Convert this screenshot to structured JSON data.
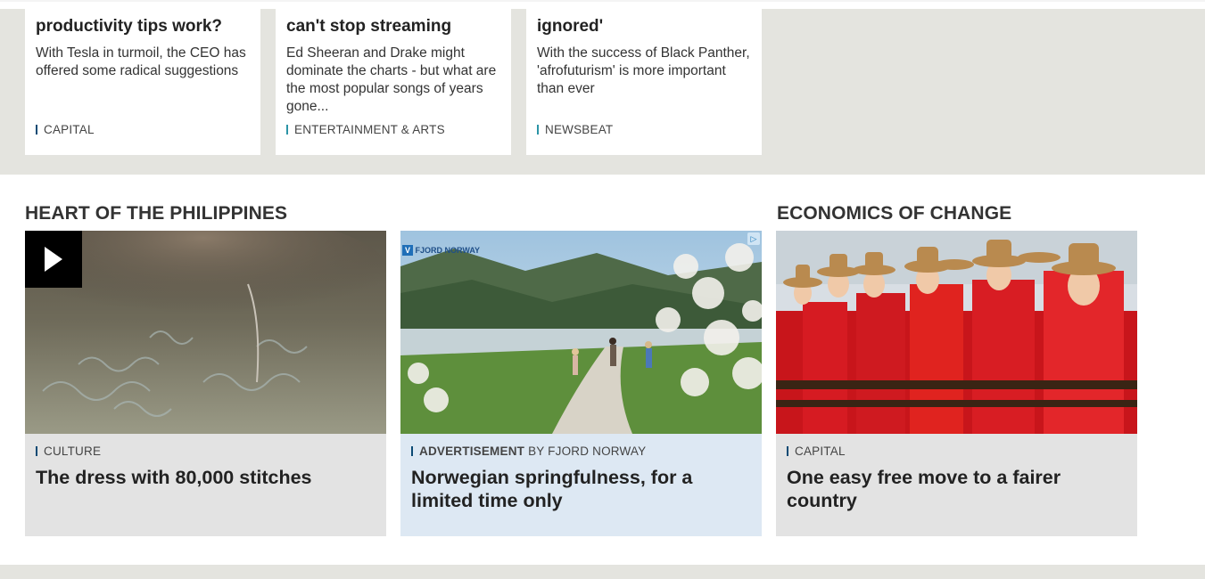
{
  "top_cards": [
    {
      "title": "productivity tips work?",
      "desc": "With Tesla in turmoil, the CEO has offered some radical suggestions",
      "section": "CAPITAL"
    },
    {
      "title": "can't stop streaming",
      "desc": "Ed Sheeran and Drake might dominate the charts - but what are the most popular songs of years gone...",
      "section": "ENTERTAINMENT & ARTS"
    },
    {
      "title": "ignored'",
      "desc": "With the success of Black Panther, 'afrofuturism' is more important than ever",
      "section": "NEWSBEAT"
    }
  ],
  "sections": {
    "left_heading": "HEART OF THE PHILIPPINES",
    "right_heading": "ECONOMICS OF CHANGE"
  },
  "promos": [
    {
      "section": "CULTURE",
      "headline": "The dress with 80,000 stitches",
      "icon": "play-icon"
    },
    {
      "ad_label": "ADVERTISEMENT",
      "sponsor": "BY FJORD NORWAY",
      "headline": "Norwegian springfulness, for a limited time only",
      "badge": "FJORD NORWAY"
    },
    {
      "section": "CAPITAL",
      "headline": "One easy free move to a fairer country"
    }
  ],
  "colors": {
    "band": "#e4e4df",
    "tag_bar": "#0b4a74",
    "ad_bg": "#dde8f3",
    "promo_bg": "#e3e3e3"
  }
}
